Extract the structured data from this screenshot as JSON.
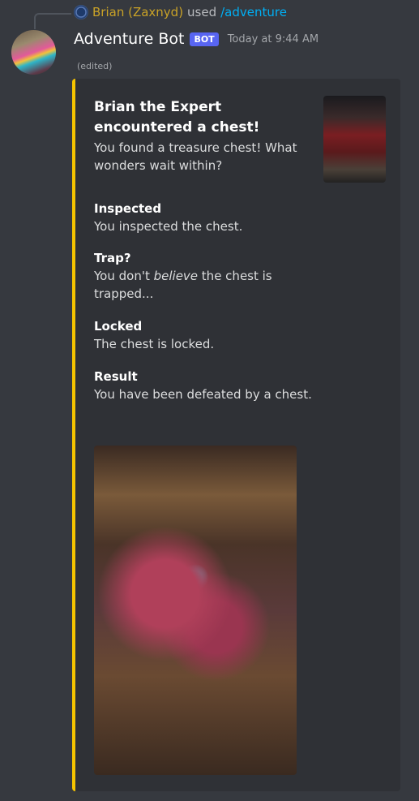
{
  "reply": {
    "user": "Brian (Zaxnyd)",
    "used": "used",
    "command": "/adventure"
  },
  "message": {
    "author": "Adventure Bot",
    "badge": "BOT",
    "timestamp": "Today at 9:44 AM",
    "edited": "(edited)"
  },
  "embed": {
    "color": "#f5c400",
    "title": "Brian the Expert encountered a chest!",
    "description": "You found a treasure chest! What wonders wait within?",
    "fields": [
      {
        "name": "Inspected",
        "value": "You inspected the chest."
      },
      {
        "name": "Trap?",
        "value_before": "You don't ",
        "value_em": "believe",
        "value_after": " the chest is trapped..."
      },
      {
        "name": "Locked",
        "value": "The chest is locked."
      },
      {
        "name": "Result",
        "value": "You have been defeated by a chest."
      }
    ]
  }
}
